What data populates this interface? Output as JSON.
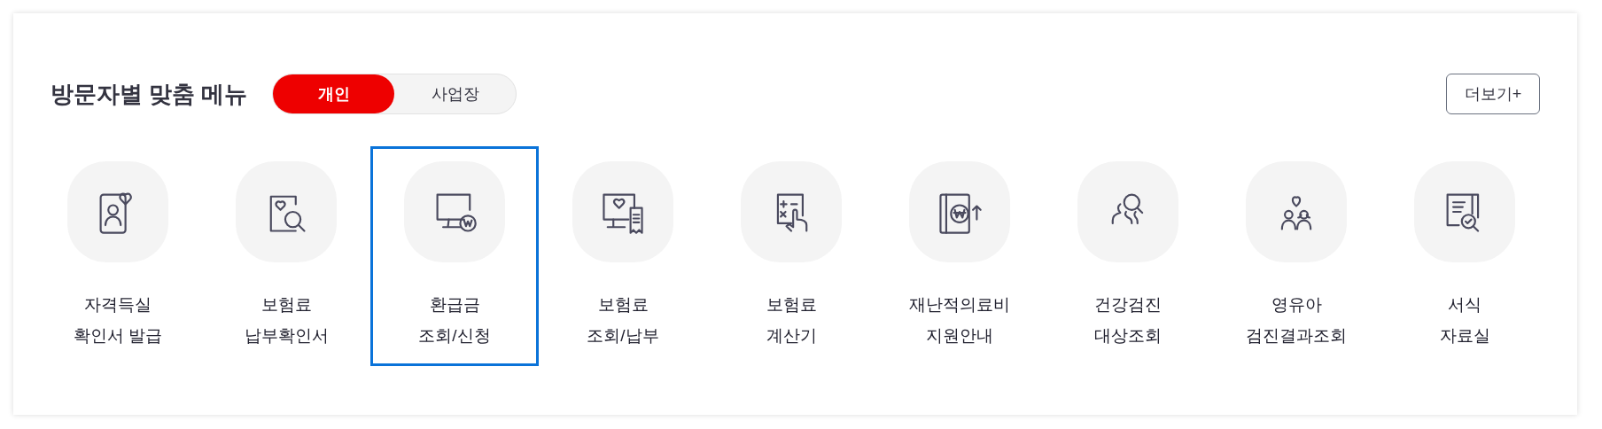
{
  "title": "방문자별 맞춤 메뉴",
  "tabs": [
    {
      "label": "개인",
      "selected": true
    },
    {
      "label": "사업장",
      "selected": false
    }
  ],
  "more_button": "더보기+",
  "menu_items": [
    {
      "label": "자격득실\n확인서 발급",
      "selected": false
    },
    {
      "label": "보험료\n납부확인서",
      "selected": false
    },
    {
      "label": "환급금\n조회/신청",
      "selected": true
    },
    {
      "label": "보험료\n조회/납부",
      "selected": false
    },
    {
      "label": "보험료\n계산기",
      "selected": false
    },
    {
      "label": "재난적의료비\n지원안내",
      "selected": false
    },
    {
      "label": "건강검진\n대상조회",
      "selected": false
    },
    {
      "label": "영유아\n검진결과조회",
      "selected": false
    },
    {
      "label": "서식\n자료실",
      "selected": false
    }
  ]
}
